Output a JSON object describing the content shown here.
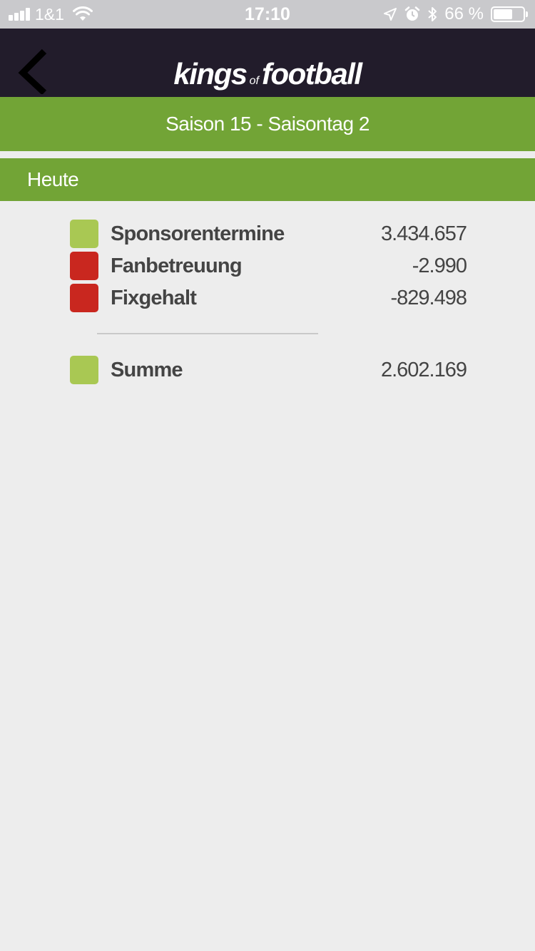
{
  "status_bar": {
    "carrier": "1&1",
    "time": "17:10",
    "battery_percent_label": "66 %",
    "battery_level": 0.66,
    "icons": [
      "signal-icon",
      "wifi-icon",
      "location-icon",
      "alarm-icon",
      "bluetooth-icon",
      "battery-icon"
    ]
  },
  "header": {
    "logo_part1": "kings",
    "logo_part2": "of",
    "logo_part3": "football",
    "back_icon": "chevron-left-icon"
  },
  "season": {
    "title": "Saison 15 - Saisontag 2"
  },
  "section": {
    "title": "Heute"
  },
  "rows": [
    {
      "label": "Sponsorentermine",
      "value": "3.434.657",
      "color": "#a9c853"
    },
    {
      "label": "Fanbetreuung",
      "value": "-2.990",
      "color": "#c9271f"
    },
    {
      "label": "Fixgehalt",
      "value": "-829.498",
      "color": "#c9271f"
    }
  ],
  "total": {
    "label": "Summe",
    "value": "2.602.169",
    "color": "#a9c853"
  },
  "colors": {
    "header_bg": "#221c2b",
    "accent_green": "#72a436",
    "positive": "#a9c853",
    "negative": "#c9271f",
    "background": "#ededed"
  }
}
